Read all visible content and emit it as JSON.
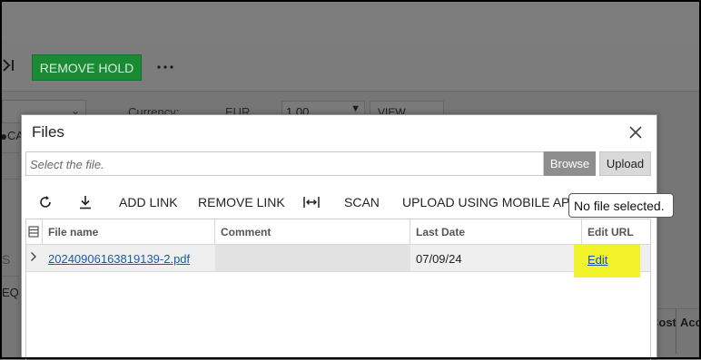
{
  "page_header": {
    "remove_hold_label": "REMOVE HOLD",
    "more_icon": "ellipsis-icon",
    "last_icon": "last-page-icon"
  },
  "background_form": {
    "currency_label": "Currency:",
    "currency_value": "EUR",
    "rate_value": "1.00",
    "view_base_label": "VIEW BASE",
    "partial_label_ca": "CA",
    "partial_label_s": "S",
    "partial_label_eq": "EQ",
    "partial_col_cost": "Cost",
    "partial_col_acc": "Acc"
  },
  "dialog": {
    "title": "Files",
    "close_icon": "close-icon",
    "file_input_placeholder": "Select the file.",
    "browse_label": "Browse",
    "upload_label": "Upload",
    "toolbar": {
      "refresh_icon": "refresh-icon",
      "download_icon": "download-icon",
      "add_link": "ADD LINK",
      "remove_link": "REMOVE LINK",
      "fit_icon": "fit-width-icon",
      "scan": "SCAN",
      "upload_mobile": "UPLOAD USING MOBILE APP"
    },
    "tooltip": "No file selected.",
    "grid": {
      "columns": [
        "File name",
        "Comment",
        "Last Date",
        "Edit URL"
      ],
      "rows": [
        {
          "file_name": "20240906163819139-2.pdf",
          "comment": "",
          "last_date": "07/09/24",
          "edit_url": "Edit"
        }
      ]
    }
  },
  "colors": {
    "primary_green": "#1b8a35",
    "highlight": "#f1f22a",
    "link": "#1a5bb5",
    "overlay": "#7c7c7c"
  }
}
